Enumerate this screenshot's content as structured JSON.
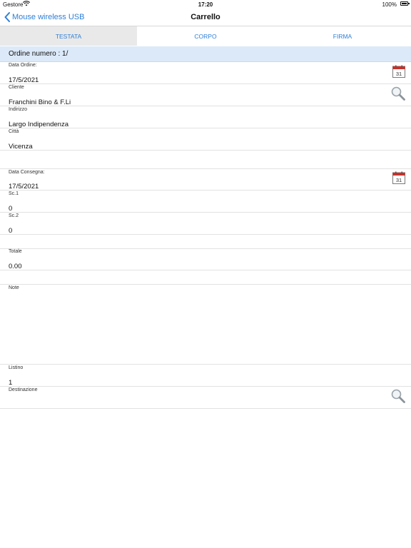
{
  "statusbar": {
    "carrier": "Gestore",
    "time": "17:20",
    "battery": "100%"
  },
  "navbar": {
    "back_label": "Mouse wireless USB",
    "title": "Carrello"
  },
  "tabs": [
    {
      "label": "TESTATA",
      "active": true
    },
    {
      "label": "CORPO",
      "active": false
    },
    {
      "label": "FIRMA",
      "active": false
    }
  ],
  "order": {
    "header": "Ordine numero : 1/"
  },
  "calendar_day": "31",
  "fields": {
    "data_ordine": {
      "label": "Data Ordine:",
      "value": "17/5/2021"
    },
    "cliente": {
      "label": "Cliente",
      "value": "Franchini Bino & F.Li"
    },
    "indirizzo": {
      "label": "Indirizzo",
      "value": "Largo Indipendenza"
    },
    "citta": {
      "label": "Città",
      "value": "Vicenza"
    },
    "data_consegna": {
      "label": "Data Consegna:",
      "value": "17/5/2021"
    },
    "sc1": {
      "label": "Sc.1",
      "value": "0"
    },
    "sc2": {
      "label": "Sc.2",
      "value": "0"
    },
    "totale": {
      "label": "Totale",
      "value": "0.00"
    },
    "note": {
      "label": "Note",
      "value": ""
    },
    "listino": {
      "label": "Listino",
      "value": "1"
    },
    "destinazione": {
      "label": "Destinazione",
      "value": ""
    }
  },
  "icons": [
    "wifi-icon",
    "battery-icon",
    "back-chevron-icon",
    "calendar-icon",
    "search-icon"
  ],
  "colors": {
    "accent": "#2f7fd6",
    "order_bar": "#dce9f8",
    "active_tab": "#e9e9e9"
  }
}
